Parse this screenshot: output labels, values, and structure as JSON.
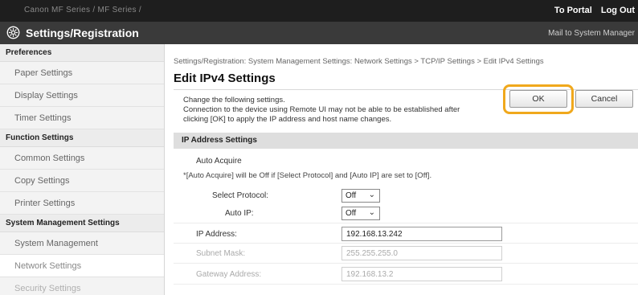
{
  "topbar": {
    "model": "Canon MF Series / MF Series /",
    "portal_link": "To Portal",
    "logout_link": "Log Out"
  },
  "header": {
    "title": "Settings/Registration",
    "mail_link": "Mail to System Manager",
    "icon": "settings-gear-icon"
  },
  "sidebar": {
    "groups": [
      {
        "heading": "Preferences",
        "items": [
          "Paper Settings",
          "Display Settings",
          "Timer Settings"
        ]
      },
      {
        "heading": "Function Settings",
        "items": [
          "Common Settings",
          "Copy Settings",
          "Printer Settings"
        ]
      },
      {
        "heading": "System Management Settings",
        "items": [
          "System Management",
          "Network Settings",
          "Security Settings"
        ]
      }
    ]
  },
  "main": {
    "breadcrumb": "Settings/Registration: System Management Settings: Network Settings > TCP/IP Settings > Edit IPv4 Settings",
    "title": "Edit IPv4 Settings",
    "note_line1": "Change the following settings.",
    "note_line2": "Connection to the device using Remote UI may not be able to be established after",
    "note_line3": "clicking [OK] to apply the IP address and host name changes.",
    "ok_label": "OK",
    "cancel_label": "Cancel",
    "highlight_color": "#f0a81c",
    "section_title": "IP Address Settings",
    "auto_acquire_label": "Auto Acquire",
    "auto_acquire_note": "*[Auto Acquire] will be Off if [Select Protocol] and [Auto IP] are set to [Off].",
    "select_protocol_label": "Select Protocol:",
    "select_protocol_value": "Off",
    "auto_ip_label": "Auto IP:",
    "auto_ip_value": "Off",
    "ip_label": "IP Address:",
    "ip_value": "192.168.13.242",
    "subnet_label": "Subnet Mask:",
    "subnet_value": "255.255.255.0",
    "gateway_label": "Gateway Address:",
    "gateway_value": "192.168.13.2"
  }
}
